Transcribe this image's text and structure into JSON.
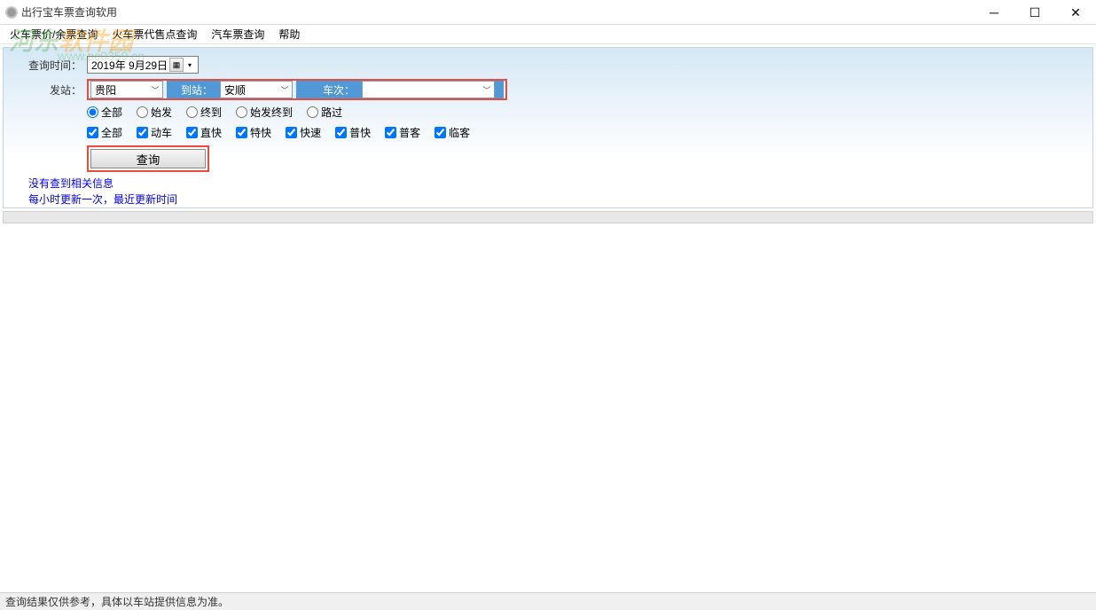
{
  "window": {
    "title": "出行宝车票查询软用"
  },
  "menu": [
    "火车票价/余票查询",
    "火车票代售点查询",
    "汽车票查询",
    "帮助"
  ],
  "watermark": {
    "brand_left": "河东",
    "brand_right": "软件园",
    "url": "www.pc0359.cn"
  },
  "form": {
    "query_time_label": "查询时间：",
    "date_value": "2019年 9月29日",
    "depart_label": "发站：",
    "depart_value": "贵阳",
    "arrive_label": "到站：",
    "arrive_value": "安顺",
    "train_label": "车次：",
    "train_value": ""
  },
  "radios": {
    "items": [
      "全部",
      "始发",
      "终到",
      "始发终到",
      "路过"
    ],
    "selected": 0
  },
  "checks": {
    "items": [
      "全部",
      "动车",
      "直快",
      "特快",
      "快速",
      "普快",
      "普客",
      "临客"
    ],
    "checked": [
      true,
      true,
      true,
      true,
      true,
      true,
      true,
      true
    ]
  },
  "search_btn": "查询",
  "info": {
    "line1": "没有查到相关信息",
    "line2": "每小时更新一次，最近更新时间"
  },
  "status": "查询结果仅供参考，具体以车站提供信息为准。"
}
